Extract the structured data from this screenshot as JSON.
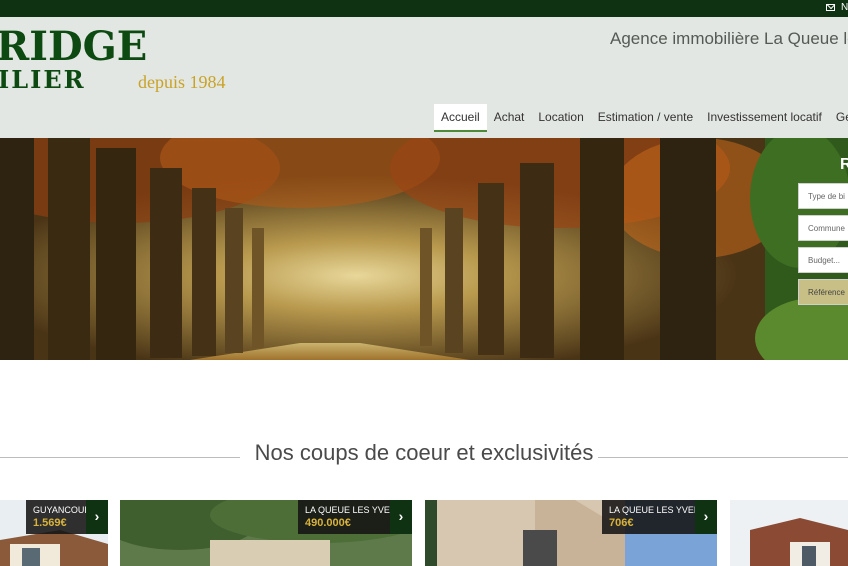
{
  "topbar": {
    "contact_text": "N"
  },
  "header": {
    "logo_line1": "RIDGE",
    "logo_line2": "ILIER",
    "logo_since": "depuis 1984",
    "tagline": "Agence immobilière La Queue les"
  },
  "nav": {
    "items": [
      "Accueil",
      "Achat",
      "Location",
      "Estimation / vente",
      "Investissement locatif",
      "Gestion"
    ],
    "active": "Accueil"
  },
  "search": {
    "title": "R",
    "fields": [
      "Type de bi",
      "Commune",
      "Budget...",
      "Référence"
    ]
  },
  "section": {
    "title": "Nos coups de coeur et exclusivités"
  },
  "cards": [
    {
      "city": "GUYANCOURT",
      "price": "1.569€"
    },
    {
      "city": "LA QUEUE LES YVELINES",
      "price": "490.000€"
    },
    {
      "city": "LA QUEUE LES YVELINES",
      "price": "706€"
    },
    {
      "city": "",
      "price": ""
    }
  ],
  "colors": {
    "topbar": "#0f3312",
    "brand_green": "#0c4a12",
    "gold": "#c9a227",
    "nav_active": "#4f8a3a"
  }
}
